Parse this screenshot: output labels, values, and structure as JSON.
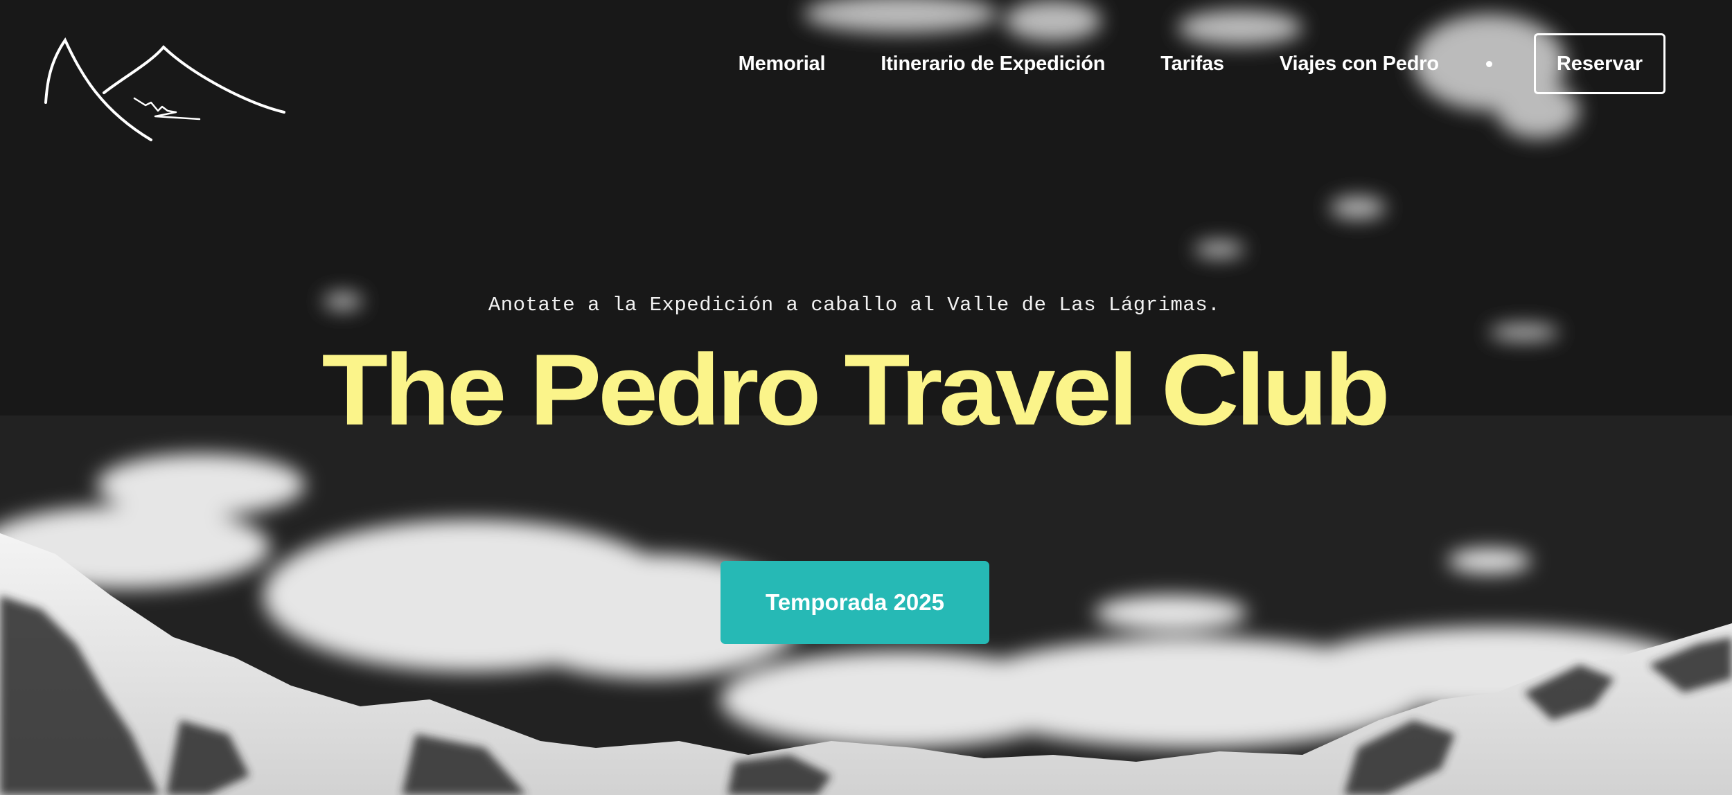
{
  "brand": {
    "logo_icon": "mountain-sketch-icon"
  },
  "nav": {
    "items": [
      {
        "label": "Memorial"
      },
      {
        "label": "Itinerario de Expedición"
      },
      {
        "label": "Tarifas"
      },
      {
        "label": "Viajes con Pedro"
      }
    ],
    "reserve_label": "Reservar"
  },
  "hero": {
    "subtitle": "Anotate a la Expedición a caballo al Valle de Las Lágrimas.",
    "title": "The Pedro Travel Club",
    "cta_label": "Temporada 2025",
    "background_image": "black-and-white-snowy-mountains-clouds"
  },
  "colors": {
    "title": "#fbf48a",
    "cta": "#26b9b5",
    "nav_text": "#ffffff",
    "sky": "#161616"
  }
}
